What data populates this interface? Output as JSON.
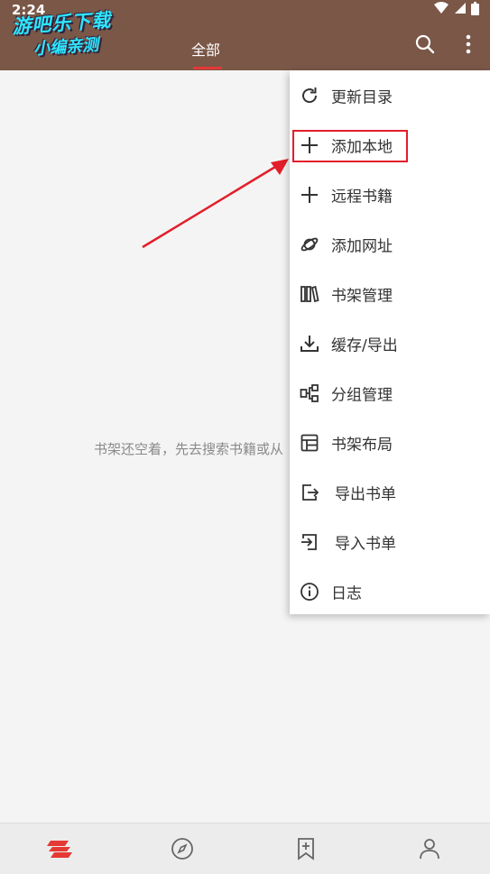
{
  "status_bar": {
    "time": "2:24"
  },
  "watermark": {
    "line1": "游吧乐下载",
    "line2": "小编亲测"
  },
  "appbar": {
    "tab_all_label": "全部",
    "accent_color": "#e53935",
    "background_color": "#7a5747",
    "search_icon": "search-icon",
    "more_icon": "more-vertical-icon"
  },
  "shelf": {
    "empty_text": "书架还空着，先去搜索书籍或从"
  },
  "menu": {
    "items": [
      {
        "label": "更新目录",
        "icon": "refresh-icon"
      },
      {
        "label": "添加本地",
        "icon": "plus-icon"
      },
      {
        "label": "远程书籍",
        "icon": "plus-icon"
      },
      {
        "label": "添加网址",
        "icon": "planet-icon"
      },
      {
        "label": "书架管理",
        "icon": "books-icon"
      },
      {
        "label": "缓存/导出",
        "icon": "download-icon"
      },
      {
        "label": "分组管理",
        "icon": "group-icon"
      },
      {
        "label": "书架布局",
        "icon": "layout-icon"
      },
      {
        "label": "导出书单",
        "icon": "export-icon"
      },
      {
        "label": "导入书单",
        "icon": "import-icon"
      },
      {
        "label": "日志",
        "icon": "info-icon"
      }
    ],
    "highlighted_item": "添加本地"
  },
  "bottom_nav": {
    "items": [
      {
        "icon": "bookshelf-logo-icon",
        "active": true
      },
      {
        "icon": "compass-icon"
      },
      {
        "icon": "bookmark-add-icon"
      },
      {
        "icon": "person-icon"
      }
    ]
  }
}
